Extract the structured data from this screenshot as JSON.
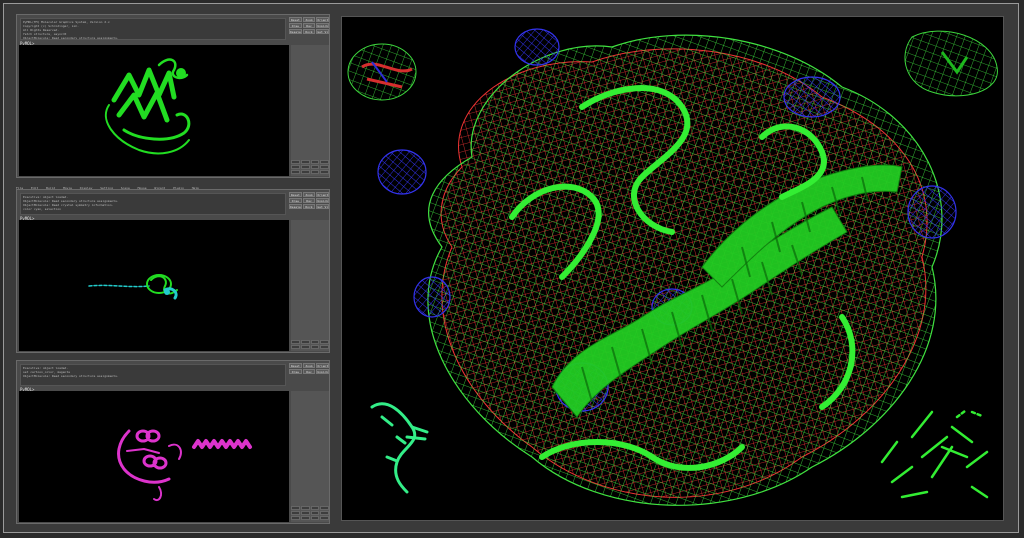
{
  "panels": [
    {
      "cmd_lines": [
        "PyMOL(TM) Molecular Graphics System, Version 2.x",
        "Copyright (c) Schrodinger, LLC.",
        "All Rights Reserved.",
        "fetch structure, async=0",
        "ObjectMolecule: Read secondary structure assignments.",
        "show cartoon"
      ],
      "buttons": [
        "Reset",
        "Zoom",
        "Orient",
        "Draw",
        "Ray",
        "Unpick",
        "Deselect",
        "Rock",
        "Get View"
      ],
      "prompt": "PyMOL>",
      "accent": "#22dd22"
    },
    {
      "cmd_lines": [
        "Executive: object loaded.",
        "ObjectMolecule: Read secondary structure assignments.",
        "ObjectMolecule: Read crystal symmetry information.",
        "color cyan, selection"
      ],
      "buttons": [
        "Reset",
        "Zoom",
        "Orient",
        "Draw",
        "Ray",
        "Unpick",
        "Deselect",
        "Rock",
        "Get View"
      ],
      "prompt": "PyMOL>",
      "accent": "#22cccc"
    },
    {
      "cmd_lines": [
        "Executive: object loaded.",
        "set cartoon_color, magenta",
        "ObjectMolecule: Read secondary structure assignments."
      ],
      "buttons": [
        "Reset",
        "Zoom",
        "Orient",
        "Draw",
        "Ray",
        "Unpick",
        "Deselect",
        "Rock",
        "Get View"
      ],
      "prompt": "PyMOL>",
      "accent": "#dd33cc"
    }
  ],
  "menu_items": [
    "File",
    "Edit",
    "Build",
    "Movie",
    "Display",
    "Setting",
    "Scene",
    "Mouse",
    "Wizard",
    "Plugin",
    "Help"
  ],
  "colors": {
    "mesh_green": "#44ee44",
    "mesh_red": "#ee3333",
    "mesh_blue": "#3333ee",
    "ribbon": "#22dd22",
    "cyan": "#22cccc",
    "magenta": "#dd33cc"
  }
}
